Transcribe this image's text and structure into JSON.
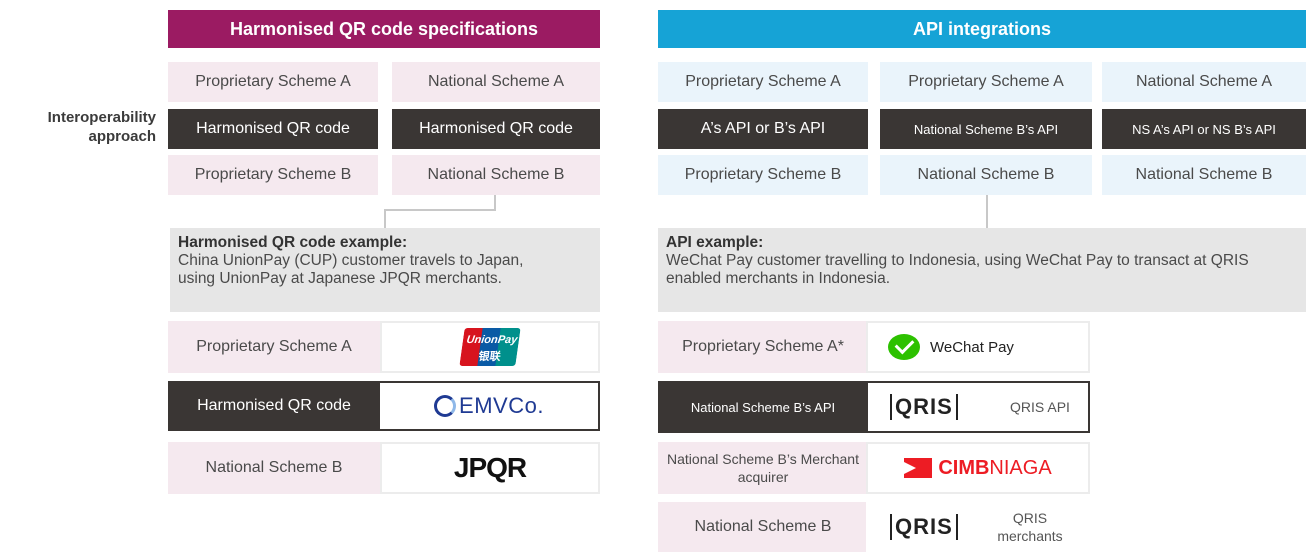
{
  "left": {
    "header": "Harmonised QR code specifications",
    "grid": [
      [
        "Proprietary Scheme A",
        "National Scheme A"
      ],
      [
        "Harmonised QR code",
        "Harmonised QR code"
      ],
      [
        "Proprietary Scheme B",
        "National Scheme B"
      ]
    ],
    "example_title": "Harmonised QR code example:",
    "example_text": "China UnionPay (CUP) customer travels to Japan, using UnionPay at Japanese JPQR merchants.",
    "rows": [
      {
        "label": "Proprietary Scheme A",
        "logo": "UnionPay",
        "logo_sub": "银联"
      },
      {
        "label": "Harmonised QR code",
        "logo": "EMVCo."
      },
      {
        "label": "National Scheme B",
        "logo": "JPQR"
      }
    ]
  },
  "right": {
    "header": "API integrations",
    "grid": [
      [
        "Proprietary Scheme A",
        "Proprietary Scheme A",
        "National Scheme A"
      ],
      [
        "A’s API or B’s API",
        "National Scheme B’s API",
        "NS A’s API or NS B’s API"
      ],
      [
        "Proprietary Scheme B",
        "National Scheme B",
        "National Scheme B"
      ]
    ],
    "example_title": "API example:",
    "example_text": "WeChat Pay customer travelling to Indonesia, using WeChat Pay to transact at QRIS enabled merchants in Indonesia.",
    "rows": [
      {
        "label": "Proprietary Scheme A*",
        "logo": "WeChat Pay"
      },
      {
        "label": "National Scheme B’s API",
        "logo": "QRIS",
        "note": "QRIS API"
      },
      {
        "label": "National Scheme B’s Merchant acquirer",
        "logo": "CIMB",
        "logo2": "NIAGA"
      },
      {
        "label": "National Scheme B",
        "logo": "QRIS",
        "note": "QRIS merchants"
      }
    ]
  },
  "side_label": "Interoperability approach",
  "colors": {
    "left_header": "#9b1b62",
    "right_header": "#16a3d6",
    "dark_cell": "#3a3634",
    "pink_cell": "#f5e9ef",
    "blue_cell": "#eaf4fb",
    "example_box": "#e6e6e6",
    "unionpay_red": "#d7141e",
    "unionpay_blue": "#0a5aa5",
    "wechat_green": "#2dc100",
    "cimb_red": "#ed1c24",
    "emvco_blue": "#1f3a93"
  }
}
